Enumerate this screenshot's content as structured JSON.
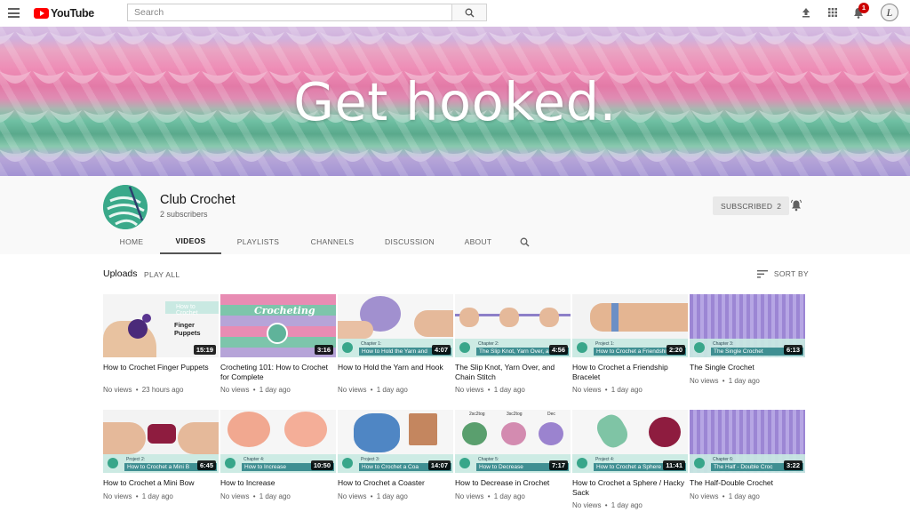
{
  "masthead": {
    "logo_text": "YouTube",
    "search_placeholder": "Search",
    "notification_count": "1",
    "avatar_initial": "L"
  },
  "banner": {
    "title": "Get hooked."
  },
  "channel": {
    "name": "Club Crochet",
    "subscribers": "2 subscribers",
    "subscribed_label": "SUBSCRIBED",
    "subscribed_count": "2"
  },
  "tabs": [
    {
      "label": "HOME",
      "active": false
    },
    {
      "label": "VIDEOS",
      "active": true
    },
    {
      "label": "PLAYLISTS",
      "active": false
    },
    {
      "label": "CHANNELS",
      "active": false
    },
    {
      "label": "DISCUSSION",
      "active": false
    },
    {
      "label": "ABOUT",
      "active": false
    }
  ],
  "section": {
    "title": "Uploads",
    "play_all": "PLAY ALL",
    "sort_by": "SORT BY"
  },
  "videos": [
    {
      "title": "How to Crochet Finger Puppets",
      "views": "No views",
      "age": "23 hours ago",
      "duration": "15:19",
      "overlay_top": "How to Crochet",
      "overlay_main": "Finger Puppets"
    },
    {
      "title": "Crocheting 101: How to Crochet for Complete",
      "views": "No views",
      "age": "1 day ago",
      "duration": "3:16",
      "overlay_top": "Crocheting"
    },
    {
      "title": "How to Hold the Yarn and Hook",
      "views": "No views",
      "age": "1 day ago",
      "duration": "4:07",
      "chapter": "Chapter 1:",
      "strip_title": "How to Hold the Yarn and"
    },
    {
      "title": "The Slip Knot, Yarn Over, and Chain Stitch",
      "views": "No views",
      "age": "1 day ago",
      "duration": "4:56",
      "chapter": "Chapter 2:",
      "strip_title": "The Slip Knot, Yarn Over, and Ch"
    },
    {
      "title": "How to Crochet a Friendship Bracelet",
      "views": "No views",
      "age": "1 day ago",
      "duration": "2:20",
      "chapter": "Project 1:",
      "strip_title": "How to Crochet a Friendship B"
    },
    {
      "title": "The Single Crochet",
      "views": "No views",
      "age": "1 day ago",
      "duration": "6:13",
      "chapter": "Chapter 3:",
      "strip_title": "The Single Crochet"
    },
    {
      "title": "How to Crochet a Mini Bow",
      "views": "No views",
      "age": "1 day ago",
      "duration": "6:45",
      "chapter": "Project 2:",
      "strip_title": "How to Crochet a Mini B"
    },
    {
      "title": "How to Increase",
      "views": "No views",
      "age": "1 day ago",
      "duration": "10:50",
      "chapter": "Chapter 4:",
      "strip_title": "How to Increase"
    },
    {
      "title": "How to Crochet a Coaster",
      "views": "No views",
      "age": "1 day ago",
      "duration": "14:07",
      "chapter": "Project 3:",
      "strip_title": "How to Crochet a Coa"
    },
    {
      "title": "How to Decrease in Crochet",
      "views": "No views",
      "age": "1 day ago",
      "duration": "7:17",
      "chapter": "Chapter 5:",
      "strip_title": "How to Decrease",
      "labels": [
        "2sc2tog",
        "3sc2tog",
        "Dec"
      ]
    },
    {
      "title": "How to Crochet a Sphere / Hacky Sack",
      "views": "No views",
      "age": "1 day ago",
      "duration": "11:41",
      "chapter": "Project 4:",
      "strip_title": "How to Crochet a Sphere / H"
    },
    {
      "title": "The Half-Double Crochet",
      "views": "No views",
      "age": "1 day ago",
      "duration": "3:22",
      "chapter": "Chapter 6:",
      "strip_title": "The Half - Double Croc"
    }
  ],
  "meta_separator": "•",
  "colors": {
    "brand_red": "#ff0000",
    "strip_teal": "#3f8f92",
    "strip_bg": "#c9e9e2",
    "yarn_pink": "#e37aa7",
    "yarn_green": "#5aa98c",
    "yarn_purple": "#a393d3"
  }
}
